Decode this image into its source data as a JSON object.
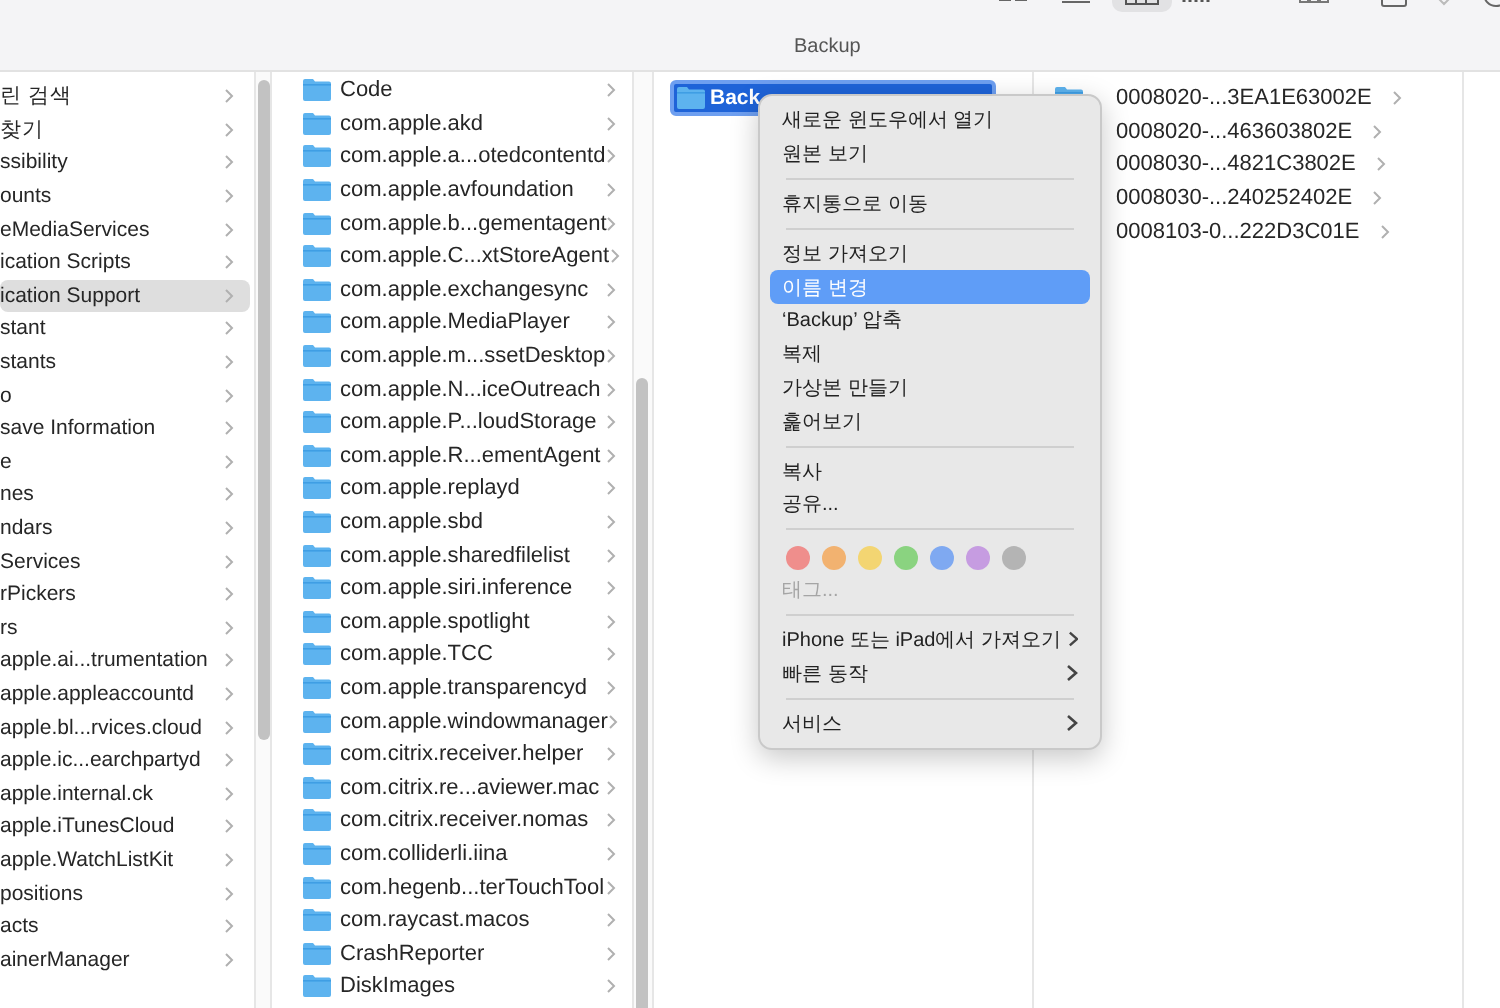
{
  "window": {
    "title": "Backup"
  },
  "columns": [
    {
      "items": [
        {
          "label": "린 검색",
          "selected": false
        },
        {
          "label": "찾기",
          "selected": false
        },
        {
          "label": "ssibility",
          "selected": false
        },
        {
          "label": "ounts",
          "selected": false
        },
        {
          "label": "eMediaServices",
          "selected": false
        },
        {
          "label": "ication Scripts",
          "selected": false
        },
        {
          "label": "ication Support",
          "selected": true
        },
        {
          "label": "stant",
          "selected": false
        },
        {
          "label": "stants",
          "selected": false
        },
        {
          "label": "o",
          "selected": false
        },
        {
          "label": "save Information",
          "selected": false
        },
        {
          "label": "e",
          "selected": false
        },
        {
          "label": "nes",
          "selected": false
        },
        {
          "label": "ndars",
          "selected": false
        },
        {
          "label": "Services",
          "selected": false
        },
        {
          "label": "rPickers",
          "selected": false
        },
        {
          "label": "rs",
          "selected": false
        },
        {
          "label": "apple.ai...trumentation",
          "selected": false
        },
        {
          "label": "apple.appleaccountd",
          "selected": false
        },
        {
          "label": "apple.bl...rvices.cloud",
          "selected": false
        },
        {
          "label": "apple.ic...earchpartyd",
          "selected": false
        },
        {
          "label": "apple.internal.ck",
          "selected": false
        },
        {
          "label": "apple.iTunesCloud",
          "selected": false
        },
        {
          "label": "apple.WatchListKit",
          "selected": false
        },
        {
          "label": "positions",
          "selected": false
        },
        {
          "label": "acts",
          "selected": false
        },
        {
          "label": "ainerManager",
          "selected": false
        }
      ]
    },
    {
      "items": [
        {
          "label": "Code",
          "selected": false
        },
        {
          "label": "com.apple.akd",
          "selected": false
        },
        {
          "label": "com.apple.a...otedcontentd",
          "selected": false
        },
        {
          "label": "com.apple.avfoundation",
          "selected": false
        },
        {
          "label": "com.apple.b...gementagent",
          "selected": false
        },
        {
          "label": "com.apple.C...xtStoreAgent",
          "selected": false
        },
        {
          "label": "com.apple.exchangesync",
          "selected": false
        },
        {
          "label": "com.apple.MediaPlayer",
          "selected": false
        },
        {
          "label": "com.apple.m...ssetDesktop",
          "selected": false
        },
        {
          "label": "com.apple.N...iceOutreach",
          "selected": false
        },
        {
          "label": "com.apple.P...loudStorage",
          "selected": false
        },
        {
          "label": "com.apple.R...ementAgent",
          "selected": false
        },
        {
          "label": "com.apple.replayd",
          "selected": false
        },
        {
          "label": "com.apple.sbd",
          "selected": false
        },
        {
          "label": "com.apple.sharedfilelist",
          "selected": false
        },
        {
          "label": "com.apple.siri.inference",
          "selected": false
        },
        {
          "label": "com.apple.spotlight",
          "selected": false
        },
        {
          "label": "com.apple.TCC",
          "selected": false
        },
        {
          "label": "com.apple.transparencyd",
          "selected": false
        },
        {
          "label": "com.apple.windowmanager",
          "selected": false
        },
        {
          "label": "com.citrix.receiver.helper",
          "selected": false
        },
        {
          "label": "com.citrix.re...aviewer.mac",
          "selected": false
        },
        {
          "label": "com.citrix.receiver.nomas",
          "selected": false
        },
        {
          "label": "com.colliderli.iina",
          "selected": false
        },
        {
          "label": "com.hegenb...terTouchTool",
          "selected": false
        },
        {
          "label": "com.raycast.macos",
          "selected": false
        },
        {
          "label": "CrashReporter",
          "selected": false
        },
        {
          "label": "DiskImages",
          "selected": false
        }
      ]
    },
    {
      "items": [
        {
          "label": "Back",
          "selected": true
        }
      ]
    },
    {
      "items": [
        {
          "label": "0008020-...3EA1E63002E",
          "selected": false
        },
        {
          "label": "0008020-...463603802E",
          "selected": false
        },
        {
          "label": "0008030-...4821C3802E",
          "selected": false
        },
        {
          "label": "0008030-...240252402E",
          "selected": false
        },
        {
          "label": "0008103-0...222D3C01E",
          "selected": false
        }
      ]
    }
  ],
  "context_menu": {
    "sections": [
      {
        "kind": "items",
        "items": [
          {
            "label": "새로운 윈도우에서 열기",
            "selected": false,
            "submenu": false,
            "disabled": false
          },
          {
            "label": "원본 보기",
            "selected": false,
            "submenu": false,
            "disabled": false
          }
        ]
      },
      {
        "kind": "items",
        "items": [
          {
            "label": "휴지통으로 이동",
            "selected": false,
            "submenu": false,
            "disabled": false
          }
        ]
      },
      {
        "kind": "items",
        "items": [
          {
            "label": "정보 가져오기",
            "selected": false,
            "submenu": false,
            "disabled": false
          },
          {
            "label": "이름 변경",
            "selected": true,
            "submenu": false,
            "disabled": false
          },
          {
            "label": "‘Backup’ 압축",
            "selected": false,
            "submenu": false,
            "disabled": false
          },
          {
            "label": "복제",
            "selected": false,
            "submenu": false,
            "disabled": false
          },
          {
            "label": "가상본 만들기",
            "selected": false,
            "submenu": false,
            "disabled": false
          },
          {
            "label": "훑어보기",
            "selected": false,
            "submenu": false,
            "disabled": false
          }
        ]
      },
      {
        "kind": "items",
        "items": [
          {
            "label": "복사",
            "selected": false,
            "submenu": false,
            "disabled": false
          },
          {
            "label": "공유...",
            "selected": false,
            "submenu": false,
            "disabled": false
          }
        ]
      },
      {
        "kind": "tags",
        "tags": [
          {
            "color": "#ef8e8c"
          },
          {
            "color": "#f2b270"
          },
          {
            "color": "#f3d572"
          },
          {
            "color": "#8ad380"
          },
          {
            "color": "#7fa9f1"
          },
          {
            "color": "#c69ce1"
          },
          {
            "color": "#b4b4b4"
          }
        ],
        "items": [
          {
            "label": "태그...",
            "selected": false,
            "submenu": false,
            "disabled": true
          }
        ]
      },
      {
        "kind": "items",
        "items": [
          {
            "label": "iPhone 또는 iPad에서 가져오기",
            "selected": false,
            "submenu": true,
            "disabled": false
          },
          {
            "label": "빠른 동작",
            "selected": false,
            "submenu": true,
            "disabled": false
          }
        ]
      },
      {
        "kind": "items",
        "items": [
          {
            "label": "서비스",
            "selected": false,
            "submenu": true,
            "disabled": false
          }
        ]
      }
    ]
  }
}
